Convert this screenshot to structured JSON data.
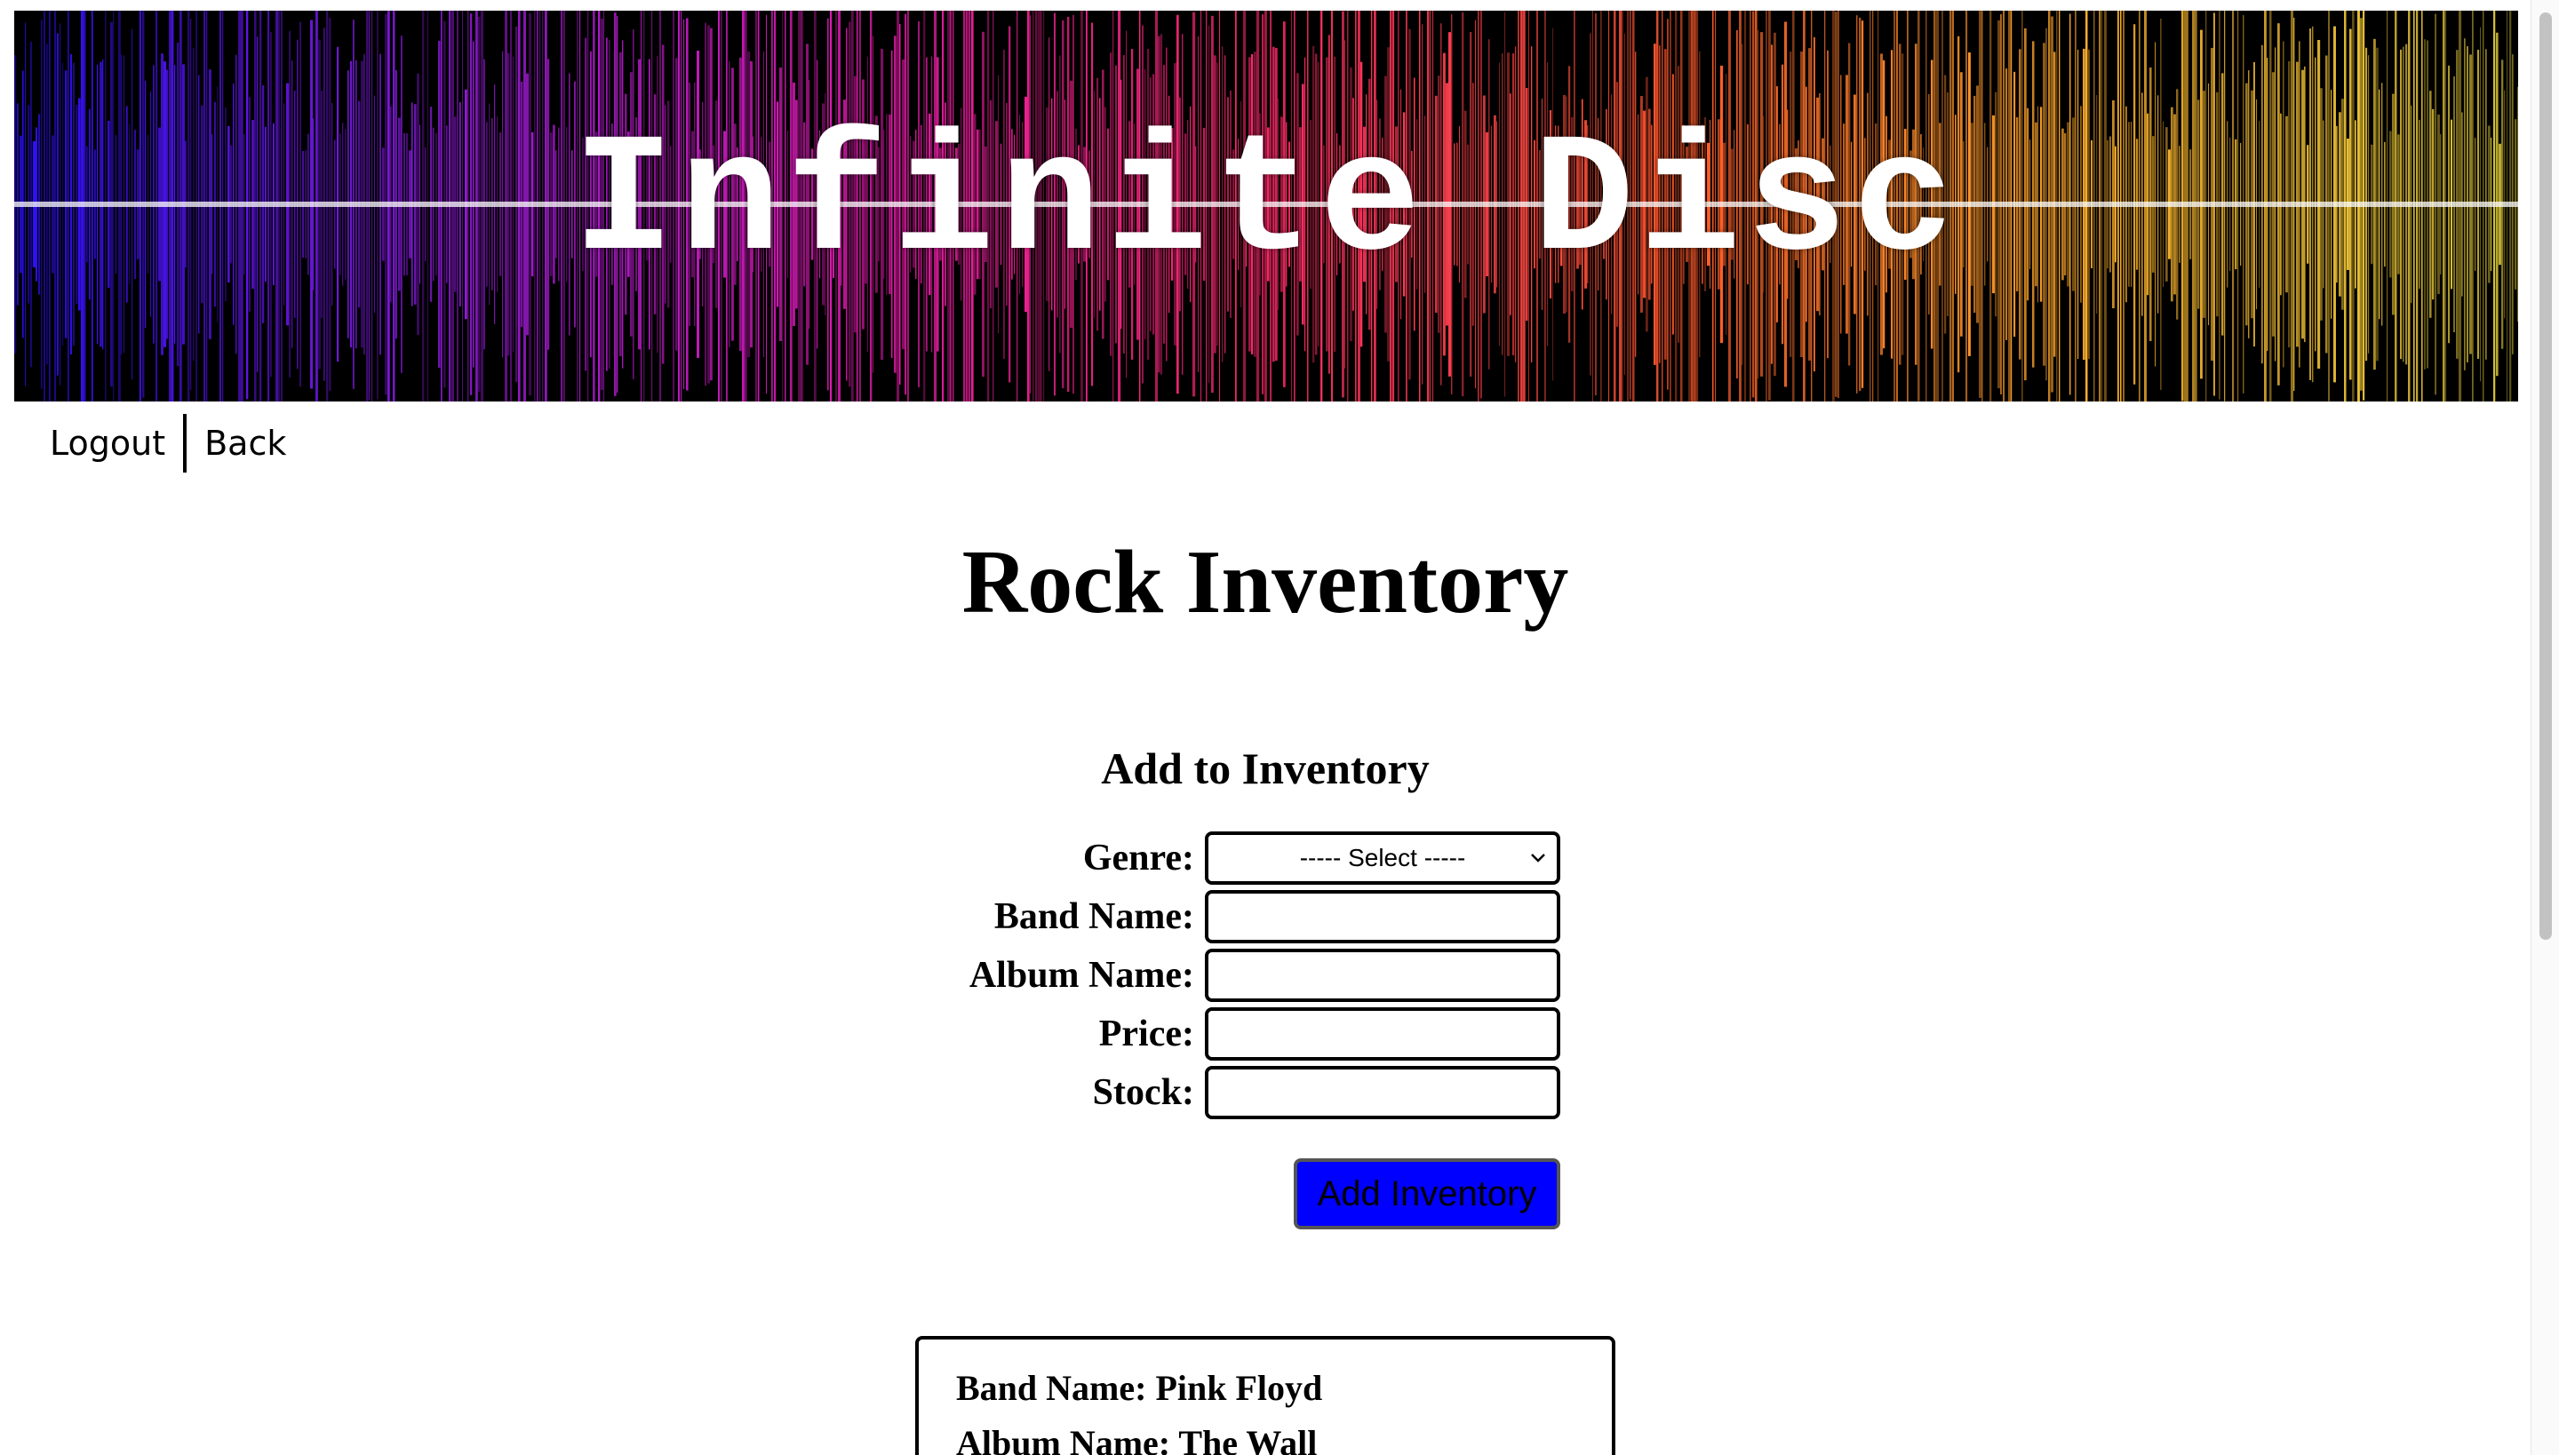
{
  "banner": {
    "title": "Infinite Disc",
    "colors": [
      "#2a10ff",
      "#8a1bd8",
      "#e01bb0",
      "#ff2b6a",
      "#ff5a2b",
      "#ffb22b",
      "#d8c83b"
    ]
  },
  "nav": {
    "logout": "Logout",
    "back": "Back"
  },
  "page": {
    "title": "Rock Inventory"
  },
  "form": {
    "title": "Add to Inventory",
    "genre_label": "Genre:",
    "genre_selected": "----- Select -----",
    "band_label": "Band Name:",
    "band_value": "",
    "album_label": "Album Name:",
    "album_value": "",
    "price_label": "Price:",
    "price_value": "",
    "stock_label": "Stock:",
    "stock_value": "",
    "submit_label": "Add Inventory",
    "submit_color": "#0000ff"
  },
  "inventory": [
    {
      "band": "Band Name: Pink Floyd",
      "album": "Album Name: The Wall"
    }
  ]
}
